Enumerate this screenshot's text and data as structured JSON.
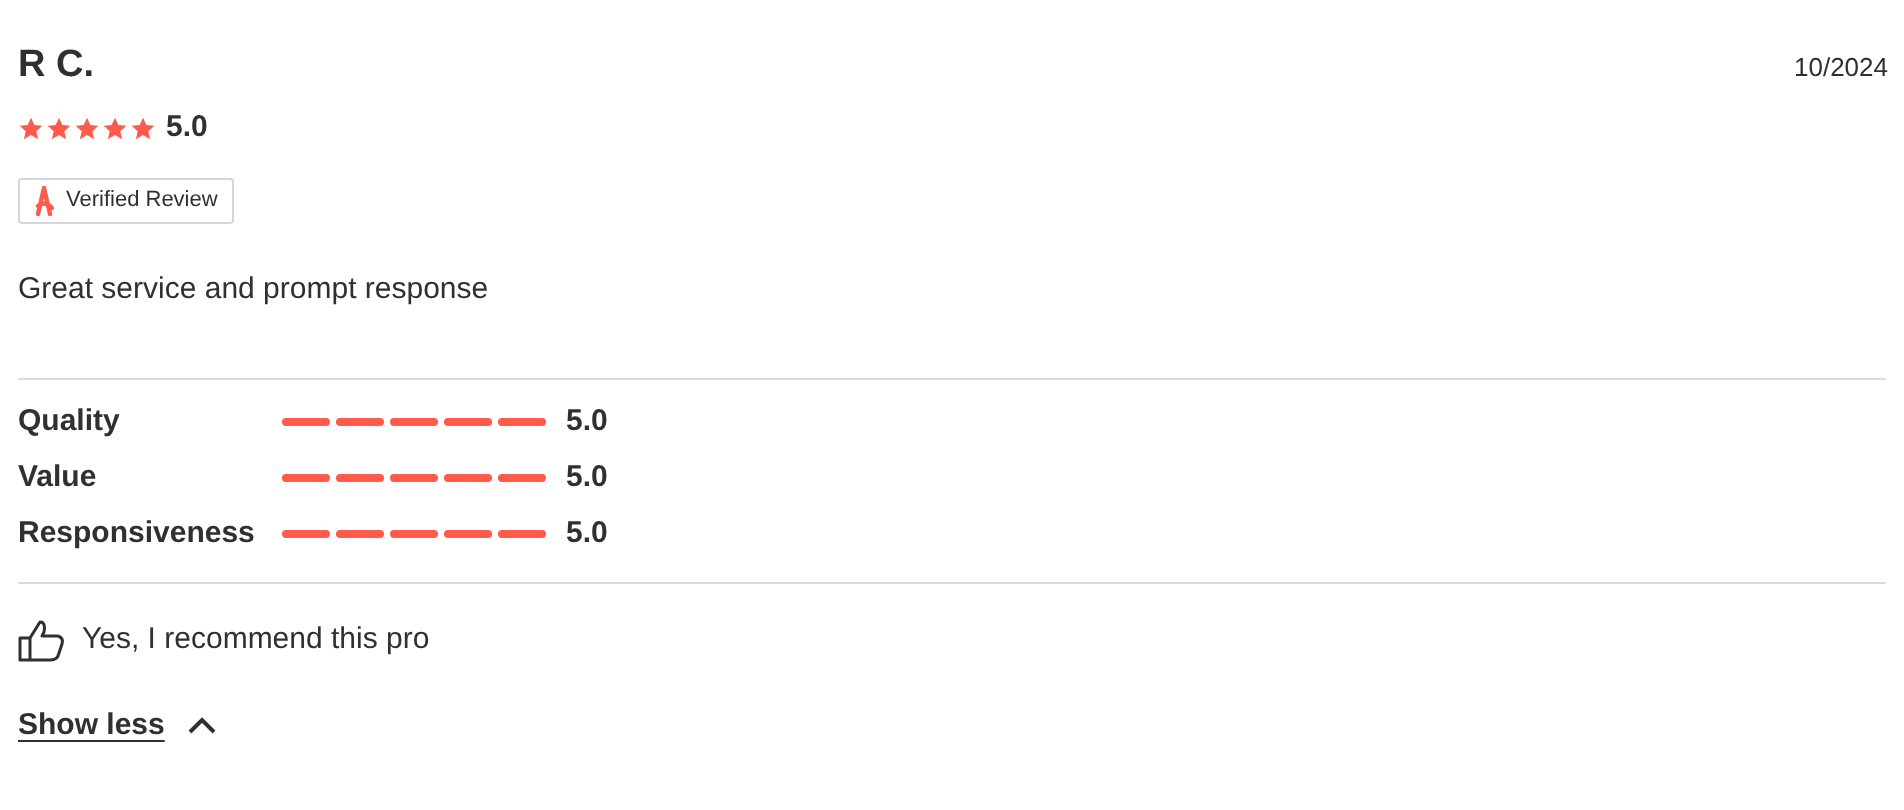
{
  "review": {
    "author": "R C.",
    "date": "10/2024",
    "stars": 5,
    "rating": "5.0",
    "badge": "Verified Review",
    "text": "Great service and prompt response"
  },
  "ratings": [
    {
      "label": "Quality",
      "stars": 5,
      "value": "5.0"
    },
    {
      "label": "Value",
      "stars": 5,
      "value": "5.0"
    },
    {
      "label": "Responsiveness",
      "stars": 5,
      "value": "5.0"
    }
  ],
  "recommend": "Yes, I recommend this pro",
  "toggle": {
    "label": "Show less",
    "expanded": true
  }
}
